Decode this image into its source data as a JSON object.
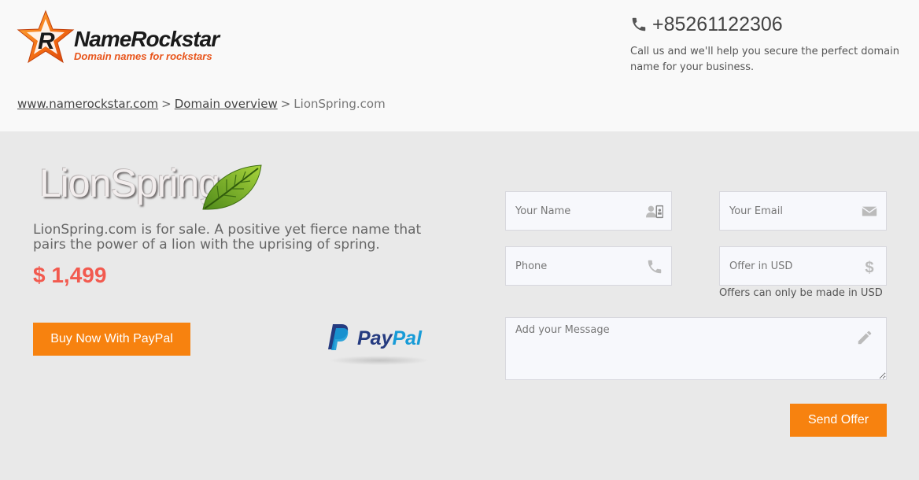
{
  "header": {
    "logo": {
      "name": "NameRockstar",
      "tagline": "Domain names for rockstars"
    },
    "contact": {
      "phone": "+85261122306",
      "text": "Call us and we'll help you secure the perfect domain name for your business."
    },
    "breadcrumb": {
      "items": [
        {
          "label": "www.namerockstar.com"
        },
        {
          "label": "Domain overview"
        }
      ],
      "separator": ">",
      "current": "LionSpring.com"
    }
  },
  "listing": {
    "logo_text": "LionSpring",
    "description": "LionSpring.com is for sale. A positive yet fierce name that pairs the power of a lion with the uprising of spring.",
    "price": "$ 1,499",
    "buy_button_label": "Buy Now With PayPal",
    "paypal_logo": {
      "pay": "Pay",
      "pal": "Pal"
    }
  },
  "form": {
    "name_placeholder": "Your Name",
    "email_placeholder": "Your Email",
    "phone_placeholder": "Phone",
    "offer_placeholder": "Offer in USD",
    "offer_note": "Offers can only be made in USD",
    "message_placeholder": "Add your Message",
    "send_button_label": "Send Offer"
  },
  "colors": {
    "accent": "#f7820f",
    "price": "#f25a4f",
    "header_bg": "#f9f9f9",
    "body_bg": "#e9e9e9"
  },
  "icons": {
    "name_field": "contact-card-icon",
    "email_field": "envelope-icon",
    "phone_field": "phone-icon",
    "offer_field": "dollar-icon",
    "message_field": "pencil-icon",
    "contact_phone": "phone-icon"
  }
}
